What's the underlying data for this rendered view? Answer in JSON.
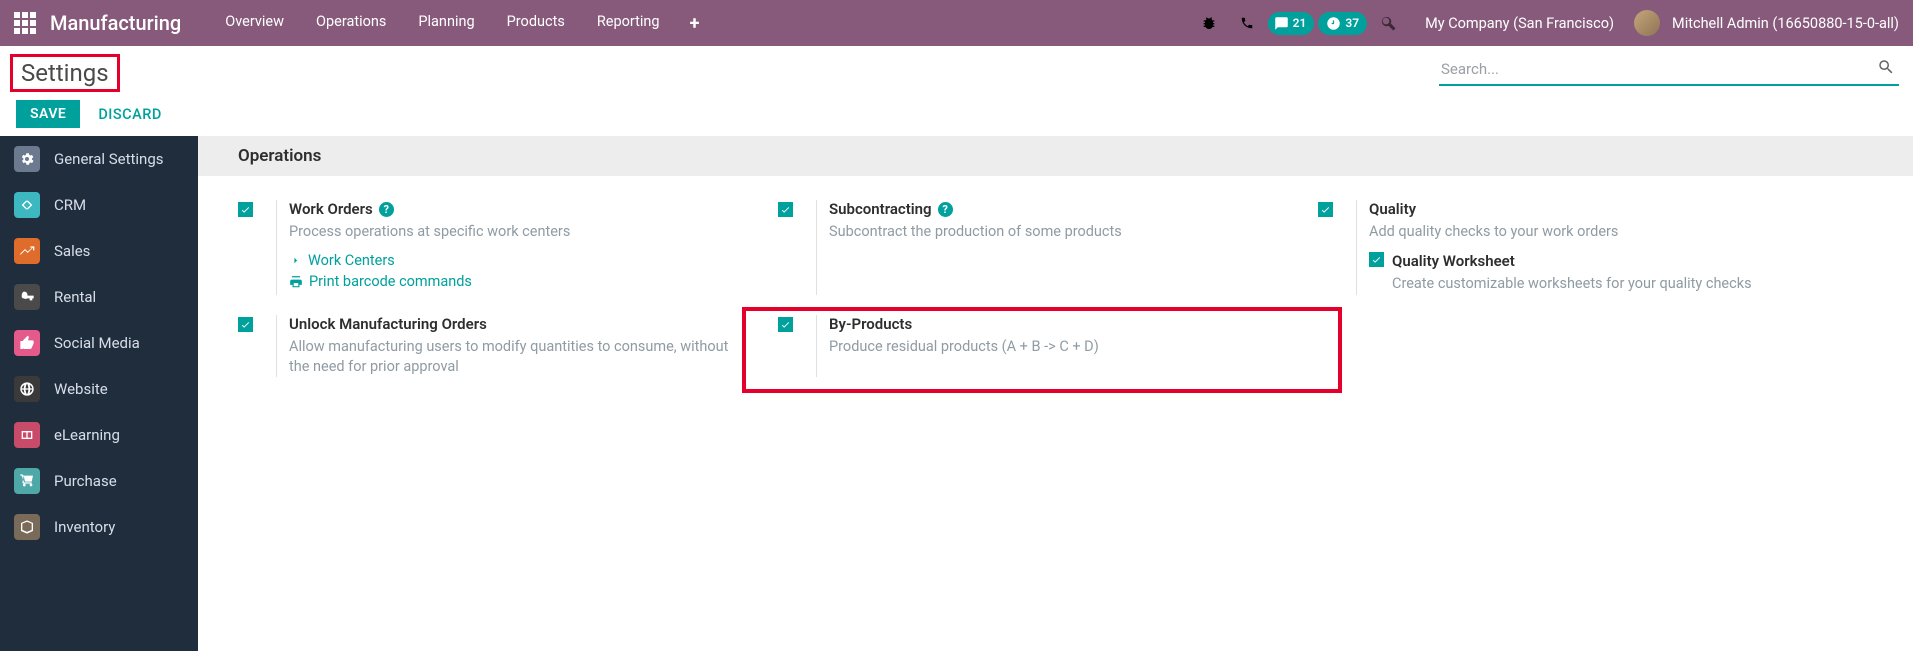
{
  "topbar": {
    "brand": "Manufacturing",
    "menu": [
      "Overview",
      "Operations",
      "Planning",
      "Products",
      "Reporting"
    ],
    "messages_count": "21",
    "activities_count": "37",
    "company": "My Company (San Francisco)",
    "user": "Mitchell Admin (16650880-15-0-all)"
  },
  "breadcrumb": {
    "title": "Settings"
  },
  "search": {
    "placeholder": "Search..."
  },
  "actions": {
    "save": "SAVE",
    "discard": "DISCARD"
  },
  "sidebar": {
    "items": [
      {
        "label": "General Settings",
        "color": "#6B7A8F"
      },
      {
        "label": "CRM",
        "color": "#3DB8C1"
      },
      {
        "label": "Sales",
        "color": "#E06C2B"
      },
      {
        "label": "Rental",
        "color": "#4A4A4A"
      },
      {
        "label": "Social Media",
        "color": "#E55A8A"
      },
      {
        "label": "Website",
        "color": "#3A3A3A"
      },
      {
        "label": "eLearning",
        "color": "#C94B6A"
      },
      {
        "label": "Purchase",
        "color": "#4FA8A8"
      },
      {
        "label": "Inventory",
        "color": "#7A6A5A"
      }
    ]
  },
  "section": {
    "title": "Operations"
  },
  "settings": {
    "work_orders": {
      "title": "Work Orders",
      "desc": "Process operations at specific work centers",
      "link1": "Work Centers",
      "link2": "Print barcode commands"
    },
    "subcontracting": {
      "title": "Subcontracting",
      "desc": "Subcontract the production of some products"
    },
    "quality": {
      "title": "Quality",
      "desc": "Add quality checks to your work orders",
      "sub_title": "Quality Worksheet",
      "sub_desc": "Create customizable worksheets for your quality checks"
    },
    "unlock": {
      "title": "Unlock Manufacturing Orders",
      "desc": "Allow manufacturing users to modify quantities to consume, without the need for prior approval"
    },
    "byproducts": {
      "title": "By-Products",
      "desc": "Produce residual products (A + B -> C + D)"
    }
  }
}
